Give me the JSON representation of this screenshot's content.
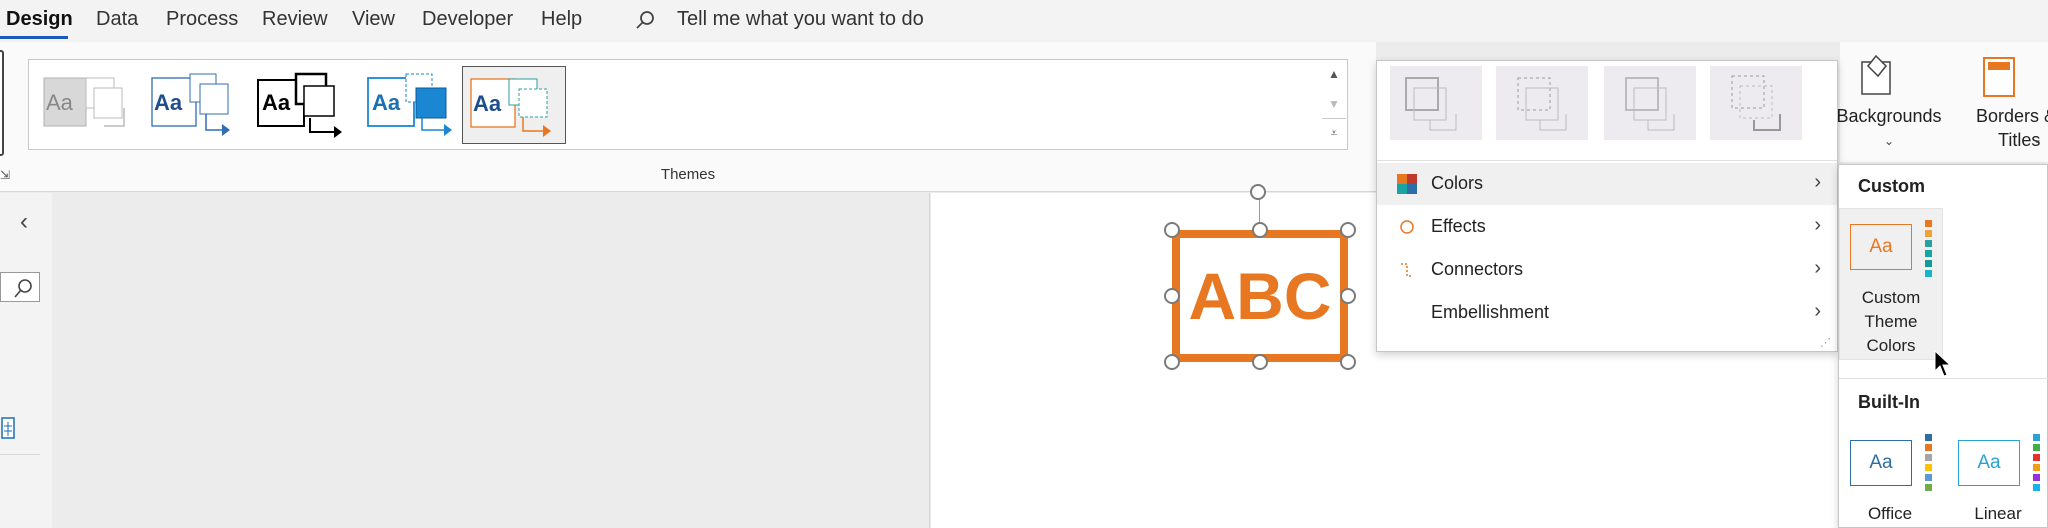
{
  "menubar": {
    "tabs": [
      {
        "label": "Design",
        "active": true
      },
      {
        "label": "Data"
      },
      {
        "label": "Process"
      },
      {
        "label": "Review"
      },
      {
        "label": "View"
      },
      {
        "label": "Developer"
      },
      {
        "label": "Help"
      }
    ],
    "search_placeholder": "Tell me what you want to do",
    "search_icon": "search-icon"
  },
  "ribbon": {
    "themes_group_label": "Themes",
    "theme_thumbnails": [
      "Aa",
      "Aa",
      "Aa",
      "Aa",
      "Aa"
    ],
    "backgrounds_label": "Backgrounds",
    "borders_label_line1": "Borders &",
    "borders_label_line2": "Titles"
  },
  "canvas": {
    "shape_text": "ABC"
  },
  "variants_menu": {
    "items": [
      {
        "label": "Colors",
        "icon": "color-squares-icon"
      },
      {
        "label": "Effects",
        "icon": "circle-icon"
      },
      {
        "label": "Connectors",
        "icon": "connector-icon"
      },
      {
        "label": "Embellishment",
        "icon": ""
      }
    ]
  },
  "colors_submenu": {
    "custom_header": "Custom",
    "custom_tile_sample": "Aa",
    "custom_tile_label": [
      "Custom",
      "Theme",
      "Colors"
    ],
    "builtin_header": "Built-In",
    "builtin_tiles": [
      {
        "sample": "Aa",
        "label": "Office"
      },
      {
        "sample": "Aa",
        "label": "Linear"
      }
    ]
  },
  "colors": {
    "accent_blue": "#185abd",
    "theme_orange": "#e87722",
    "handle_gray": "#7a7a7a"
  }
}
